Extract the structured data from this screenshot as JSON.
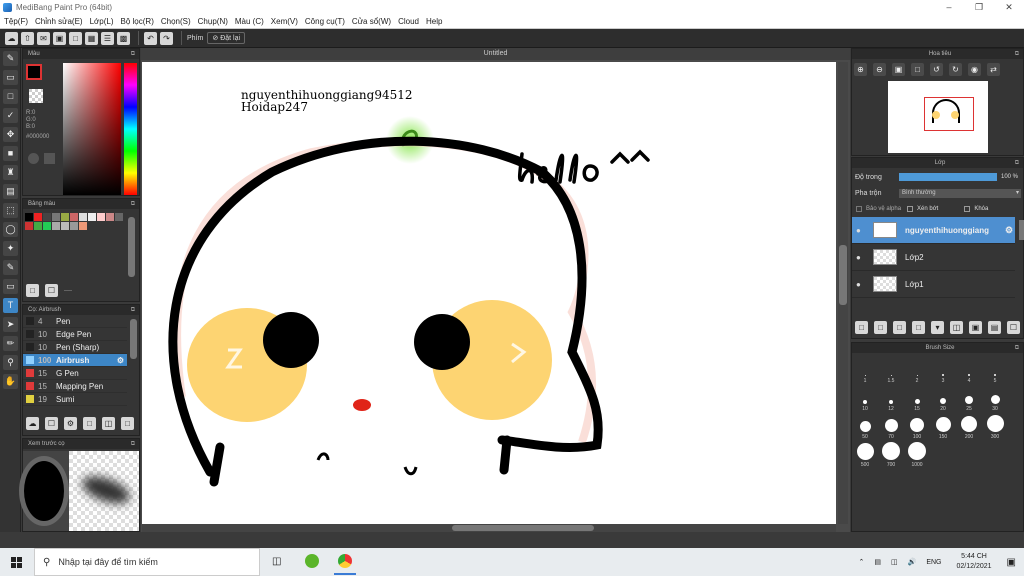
{
  "window": {
    "title": "MediBang Paint Pro (64bit)"
  },
  "menu": [
    "Tệp(F)",
    "Chỉnh sửa(E)",
    "Lớp(L)",
    "Bộ lọc(R)",
    "Chọn(S)",
    "Chụp(N)",
    "Màu (C)",
    "Xem(V)",
    "Công cụ(T)",
    "Cửa sổ(W)",
    "Cloud",
    "Help"
  ],
  "toolbar": {
    "phim_label": "Phím",
    "reset_label": "Đặt lại"
  },
  "color_panel": {
    "title": "Màu",
    "r": "R:0",
    "g": "G:0",
    "b": "B:0",
    "hex": "#000000"
  },
  "palette_panel": {
    "title": "Bảng màu",
    "footer": "----"
  },
  "brush_panel": {
    "title": "Cọ: Airbrush",
    "items": [
      {
        "size": "4",
        "name": "Pen",
        "color": "#222222"
      },
      {
        "size": "10",
        "name": "Edge Pen",
        "color": "#222222"
      },
      {
        "size": "10",
        "name": "Pen (Sharp)",
        "color": "#222222"
      },
      {
        "size": "100",
        "name": "Airbrush",
        "color": "#8fd0ff"
      },
      {
        "size": "15",
        "name": "G Pen",
        "color": "#e03a3a"
      },
      {
        "size": "15",
        "name": "Mapping Pen",
        "color": "#e03a3a"
      },
      {
        "size": "19",
        "name": "Sumi",
        "color": "#e0d040"
      }
    ]
  },
  "preview_panel": {
    "title": "Xem trước cọ"
  },
  "canvas": {
    "tab": "Untitled",
    "text1": "nguyenthihuonggiang94512",
    "text2": "Hoidap247",
    "hello": "hello^^"
  },
  "navigator": {
    "title": "Hoa tiêu"
  },
  "layer_panel": {
    "title": "Lớp",
    "opacity_label": "Độ trong",
    "opacity_value": "100 %",
    "blend_label": "Pha trộn",
    "blend_value": "Bình thường",
    "alpha_label": "Bảo vệ alpha",
    "clip_label": "Xén bớt",
    "lock_label": "Khóa",
    "layers": [
      {
        "name": "nguyenthihuonggiang",
        "selected": true
      },
      {
        "name": "Lớp2",
        "selected": false
      },
      {
        "name": "Lớp1",
        "selected": false
      }
    ]
  },
  "brush_size": {
    "title": "Brush Size",
    "sizes": [
      "1",
      "1.5",
      "2",
      "3",
      "4",
      "5",
      "10",
      "12",
      "15",
      "20",
      "25",
      "30",
      "50",
      "70",
      "100",
      "150",
      "200",
      "300",
      "500",
      "700",
      "1000"
    ]
  },
  "taskbar": {
    "search_placeholder": "Nhập tại đây để tìm kiếm",
    "lang": "ENG",
    "time": "5:44 CH",
    "date": "02/12/2021"
  }
}
